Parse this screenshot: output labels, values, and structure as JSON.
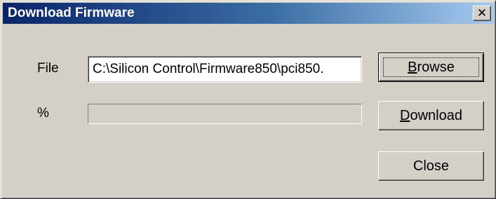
{
  "window": {
    "title": "Download Firmware",
    "close_glyph": "✕"
  },
  "form": {
    "file_label": "File",
    "file_value": "C:\\Silicon Control\\Firmware850\\pci850.",
    "progress_label": "%",
    "progress_fraction": 0
  },
  "buttons": {
    "browse": {
      "accel": "B",
      "rest": "rowse"
    },
    "download": {
      "accel": "D",
      "rest": "ownload"
    },
    "close": {
      "label": "Close"
    }
  },
  "colors": {
    "face": "#d4d0c8",
    "titlebar_start": "#0a246a",
    "titlebar_end": "#a6caf0"
  }
}
